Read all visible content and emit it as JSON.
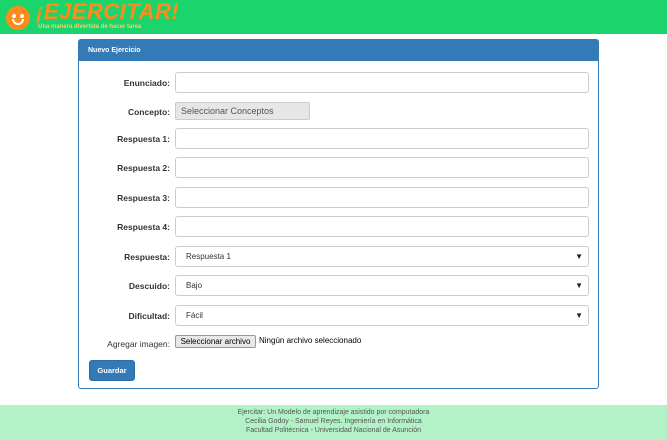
{
  "header": {
    "logo_title": "¡EJERCITAR!",
    "logo_tagline": "Una manera divertida de hacer tarea"
  },
  "form": {
    "title": "Nuevo Ejercicio",
    "enunciado_label": "Enunciado:",
    "enunciado_value": "",
    "concepto_label": "Concepto:",
    "concepto_button": "Seleccionar Conceptos",
    "respuesta1_label": "Respuesta 1:",
    "respuesta2_label": "Respuesta 2:",
    "respuesta3_label": "Respuesta 3:",
    "respuesta4_label": "Respuesta 4:",
    "respuesta_label": "Respuesta:",
    "respuesta_value": "Respuesta 1",
    "descuido_label": "Descuido:",
    "descuido_value": "Bajo",
    "dificultad_label": "Dificultad:",
    "dificultad_value": "Fácil",
    "imagen_label": "Agregar imagen:",
    "imagen_button": "Seleccionar archivo",
    "imagen_status": "Ningún archivo seleccionado",
    "save_label": "Guardar"
  },
  "footer": {
    "line1": "Ejercitar: Un Modelo de aprendizaje asistido por computadora",
    "line2": "Cecilia Godoy - Samuel Reyes. Ingeniería en Informática",
    "line3": "Facultad Politécnica - Universidad Nacional de Asunción"
  },
  "colors": {
    "header_bg": "#1bd46b",
    "brand_orange": "#ff8c1a",
    "primary": "#337ab7",
    "footer_bg": "#b3f2c7"
  }
}
